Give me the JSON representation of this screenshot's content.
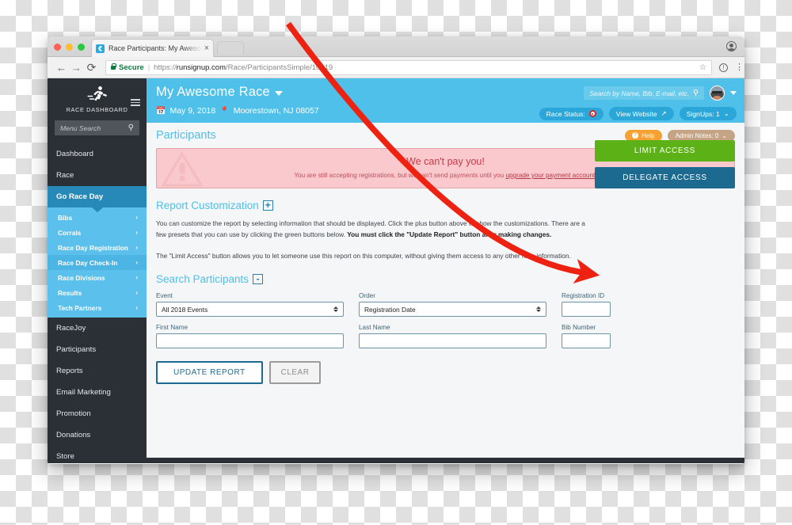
{
  "browser": {
    "tab_title": "Race Participants: My Awesom",
    "tab_close": "×",
    "back_icon": "←",
    "forward_icon": "→",
    "reload_icon": "⟳",
    "secure_label": "Secure",
    "url_sep": "|",
    "url_scheme": "https://",
    "url_host": "runsignup.com",
    "url_path": "/Race/ParticipantsSimple/10919",
    "star_icon": "☆",
    "info_icon": "!",
    "menu_icon": "⋮"
  },
  "sidebar": {
    "brand_label": "RACE DASHBOARD",
    "search_placeholder": "Menu Search",
    "search_icon": "⚲",
    "items": [
      {
        "label": "Dashboard",
        "state": "normal"
      },
      {
        "label": "Race",
        "state": "normal"
      },
      {
        "label": "Go Race Day",
        "state": "selected"
      }
    ],
    "submenu": [
      {
        "label": "Bibs",
        "current": false
      },
      {
        "label": "Corrals",
        "current": false
      },
      {
        "label": "Race Day Registration",
        "current": false
      },
      {
        "label": "Race Day Check-In",
        "current": true
      },
      {
        "label": "Race Divisions",
        "current": false
      },
      {
        "label": "Results",
        "current": false
      },
      {
        "label": "Tech Partners",
        "current": false
      }
    ],
    "items_lower": [
      {
        "label": "RaceJoy"
      },
      {
        "label": "Participants"
      },
      {
        "label": "Reports"
      },
      {
        "label": "Email Marketing"
      },
      {
        "label": "Promotion"
      },
      {
        "label": "Donations"
      },
      {
        "label": "Store"
      }
    ],
    "chevron": "›"
  },
  "race_header": {
    "title": "My Awesome Race",
    "date_icon": "📅",
    "date": "May 9, 2018",
    "location_icon": "📍",
    "location": "Moorestown, NJ 08057",
    "search_placeholder": "Search by Name, Bib, E-mail, etc.",
    "search_icon": "⚲",
    "race_status_label": "Race Status:",
    "view_website_label": "View Website",
    "view_website_icon": "↗",
    "signups_label": "SignUps: 1",
    "signups_caret": "⌄"
  },
  "page": {
    "title": "Participants",
    "help_label": "Help",
    "help_badge": "?",
    "admin_notes_label": "Admin Notes: 0",
    "admin_notes_caret": "⌄"
  },
  "alert": {
    "title": "We can't pay you!",
    "body_before": "You are still accepting registrations, but we can't send payments until you ",
    "link": "upgrade your payment account",
    "body_after": "."
  },
  "report_customization": {
    "heading": "Report Customization",
    "toggle": "+",
    "paragraph_1_a": "You can customize the report by selecting information that should be displayed. Click the plus button above to show the customizations. There are a few presets that you can use by clicking the green buttons below. ",
    "paragraph_1_b": "You must click the \"Update Report\" button after making changes.",
    "paragraph_2": "The \"Limit Access\" button allows you to let someone use this report on this computer, without giving them access to any other race information."
  },
  "access": {
    "limit_label": "LIMIT ACCESS",
    "delegate_label": "DELEGATE ACCESS",
    "limit_color": "#5cb117",
    "delegate_color": "#1d6a91"
  },
  "search_participants": {
    "heading": "Search Participants",
    "toggle": "-",
    "fields": [
      {
        "label": "Event",
        "type": "select",
        "value": "All 2018 Events"
      },
      {
        "label": "Order",
        "type": "select",
        "value": "Registration Date"
      },
      {
        "label": "Registration ID",
        "type": "text",
        "value": ""
      },
      {
        "label": "First Name",
        "type": "text",
        "value": ""
      },
      {
        "label": "Last Name",
        "type": "text",
        "value": ""
      },
      {
        "label": "Bib Number",
        "type": "text",
        "value": ""
      }
    ],
    "update_label": "UPDATE REPORT",
    "clear_label": "CLEAR"
  },
  "annotation": {
    "arrow_color": "#ee2211",
    "points_to": "DELEGATE ACCESS"
  }
}
